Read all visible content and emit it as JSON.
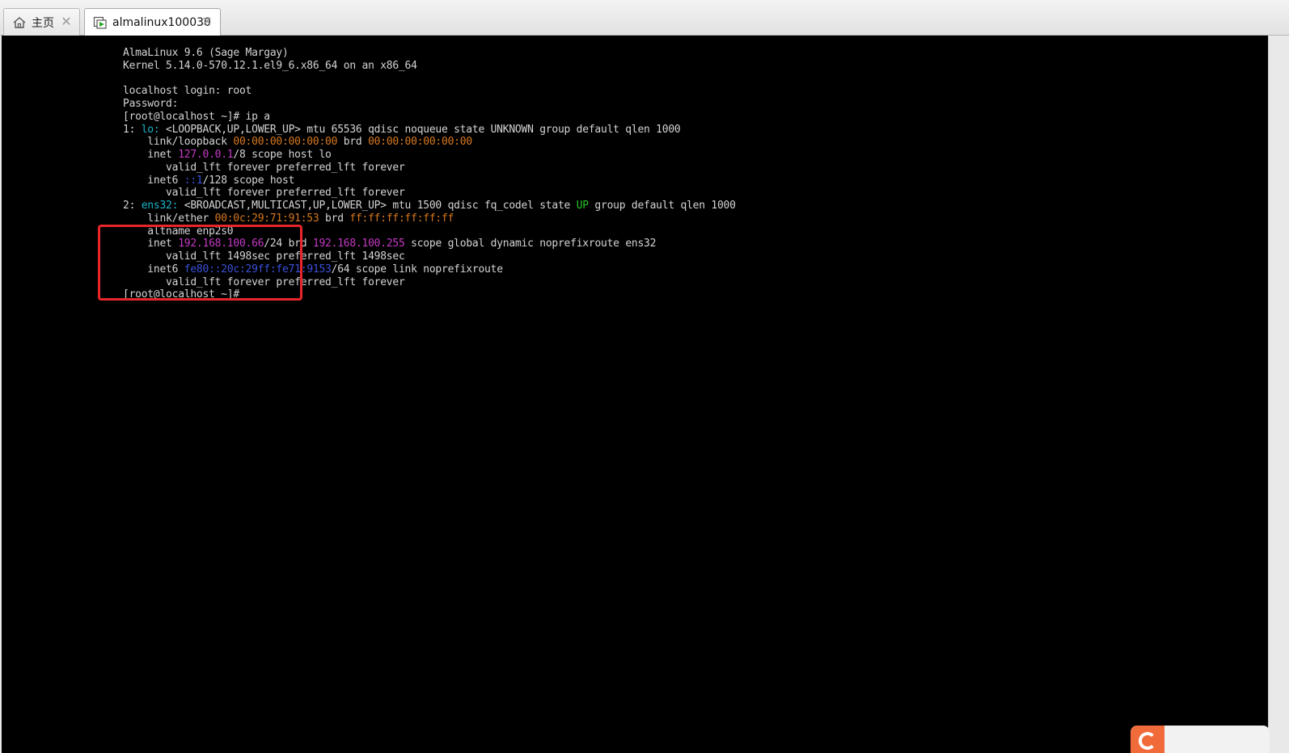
{
  "tabs": [
    {
      "label": "主页",
      "icon": "home-icon"
    },
    {
      "label": "almalinux100030",
      "icon": "vm-icon",
      "active": true
    }
  ],
  "terminal": {
    "lines": [
      [
        {
          "t": "AlmaLinux 9.6 (Sage Margay)"
        }
      ],
      [
        {
          "t": "Kernel 5.14.0-570.12.1.el9_6.x86_64 on an x86_64"
        }
      ],
      [
        {
          "t": ""
        }
      ],
      [
        {
          "t": "localhost login: root"
        }
      ],
      [
        {
          "t": "Password:"
        }
      ],
      [
        {
          "t": "[root@localhost ~]# ip a"
        }
      ],
      [
        {
          "t": "1: "
        },
        {
          "t": "lo:",
          "c": "cyan"
        },
        {
          "t": " <LOOPBACK,UP,LOWER_UP> mtu 65536 qdisc noqueue state UNKNOWN group default qlen 1000"
        }
      ],
      [
        {
          "t": "    link/loopback "
        },
        {
          "t": "00:00:00:00:00:00",
          "c": "orange"
        },
        {
          "t": " brd "
        },
        {
          "t": "00:00:00:00:00:00",
          "c": "orange"
        }
      ],
      [
        {
          "t": "    inet "
        },
        {
          "t": "127.0.0.1",
          "c": "magenta"
        },
        {
          "t": "/8 scope host lo"
        }
      ],
      [
        {
          "t": "       valid_lft forever preferred_lft forever"
        }
      ],
      [
        {
          "t": "    inet6 "
        },
        {
          "t": "::1",
          "c": "blue"
        },
        {
          "t": "/128 scope host"
        }
      ],
      [
        {
          "t": "       valid_lft forever preferred_lft forever"
        }
      ],
      [
        {
          "t": "2: "
        },
        {
          "t": "ens32:",
          "c": "cyan"
        },
        {
          "t": " <BROADCAST,MULTICAST,UP,LOWER_UP> mtu 1500 qdisc fq_codel state "
        },
        {
          "t": "UP",
          "c": "green"
        },
        {
          "t": " group default qlen 1000"
        }
      ],
      [
        {
          "t": "    link/ether "
        },
        {
          "t": "00:0c:29:71:91:53",
          "c": "orange"
        },
        {
          "t": " brd "
        },
        {
          "t": "ff:ff:ff:ff:ff:ff",
          "c": "orange"
        }
      ],
      [
        {
          "t": "    altname enp2s0"
        }
      ],
      [
        {
          "t": "    inet "
        },
        {
          "t": "192.168.100.66",
          "c": "magenta"
        },
        {
          "t": "/24 brd "
        },
        {
          "t": "192.168.100.255",
          "c": "magenta"
        },
        {
          "t": " scope global dynamic noprefixroute ens32"
        }
      ],
      [
        {
          "t": "       valid_lft 1498sec preferred_lft 1498sec"
        }
      ],
      [
        {
          "t": "    inet6 "
        },
        {
          "t": "fe80::20c:29ff:fe71:9153",
          "c": "blue"
        },
        {
          "t": "/64 scope link noprefixroute"
        }
      ],
      [
        {
          "t": "       valid_lft forever preferred_lft forever"
        }
      ],
      [
        {
          "t": "[root@localhost ~]#"
        }
      ]
    ]
  },
  "colors": {
    "highlight_box": "#e8262a",
    "console_bg": "#000000",
    "cyan": "#19b3c7",
    "orange": "#d8781e",
    "magenta": "#c43ac4",
    "blue": "#3a52d8",
    "green": "#27c227"
  }
}
